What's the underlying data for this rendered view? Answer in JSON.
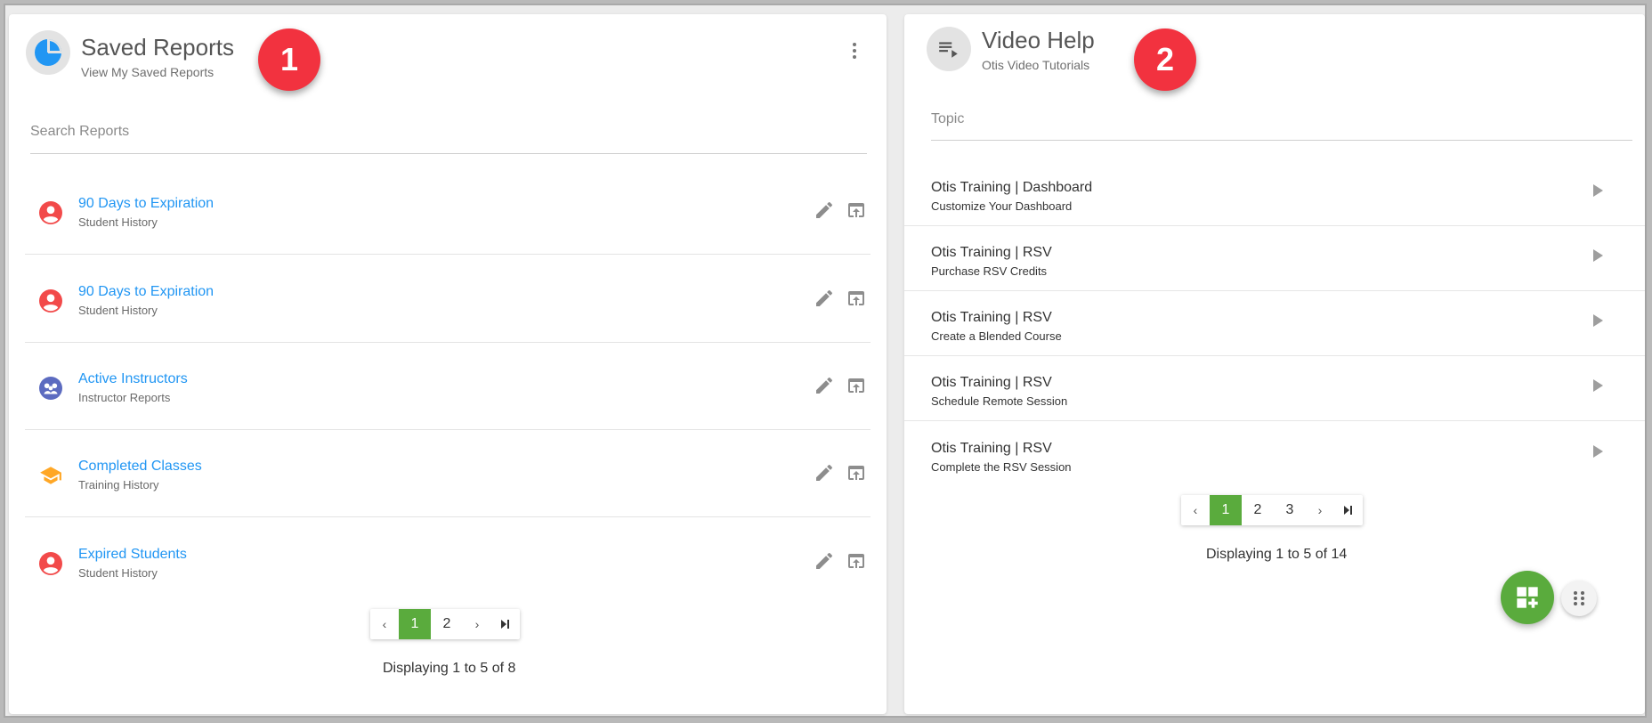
{
  "saved_reports": {
    "title": "Saved Reports",
    "subtitle": "View My Saved Reports",
    "badge": "1",
    "search_label": "Search Reports",
    "items": [
      {
        "title": "90 Days to Expiration",
        "subtitle": "Student History",
        "icon": "account-circle-icon",
        "icon_color": "#f24a4a"
      },
      {
        "title": "90 Days to Expiration",
        "subtitle": "Student History",
        "icon": "account-circle-icon",
        "icon_color": "#f24a4a"
      },
      {
        "title": "Active Instructors",
        "subtitle": "Instructor Reports",
        "icon": "instructors-icon",
        "icon_color": "#5c6bc0"
      },
      {
        "title": "Completed Classes",
        "subtitle": "Training History",
        "icon": "graduation-cap-icon",
        "icon_color": "#ffa726"
      },
      {
        "title": "Expired Students",
        "subtitle": "Student History",
        "icon": "account-circle-icon",
        "icon_color": "#f24a4a"
      }
    ],
    "pagination": {
      "pages": [
        "1",
        "2"
      ],
      "current": "1",
      "prev": "‹",
      "next": "›",
      "last": "⏭"
    },
    "display_text": "Displaying 1 to 5 of 8"
  },
  "video_help": {
    "title": "Video Help",
    "subtitle": "Otis Video Tutorials",
    "badge": "2",
    "topic_label": "Topic",
    "items": [
      {
        "title": "Otis Training | Dashboard",
        "subtitle": "Customize Your Dashboard"
      },
      {
        "title": "Otis Training | RSV",
        "subtitle": "Purchase RSV Credits"
      },
      {
        "title": "Otis Training | RSV",
        "subtitle": "Create a Blended Course"
      },
      {
        "title": "Otis Training | RSV",
        "subtitle": "Schedule Remote Session"
      },
      {
        "title": "Otis Training | RSV",
        "subtitle": "Complete the RSV Session"
      }
    ],
    "pagination": {
      "pages": [
        "1",
        "2",
        "3"
      ],
      "current": "1",
      "prev": "‹",
      "next": "›",
      "last": "⏭"
    },
    "display_text": "Displaying 1 to 5 of 14"
  },
  "colors": {
    "accent_green": "#5aab3d",
    "link_blue": "#2196f3",
    "badge_red": "#f2323f"
  },
  "fab": {
    "icon": "add-widget-icon",
    "secondary_icon": "drag-handle-icon"
  }
}
